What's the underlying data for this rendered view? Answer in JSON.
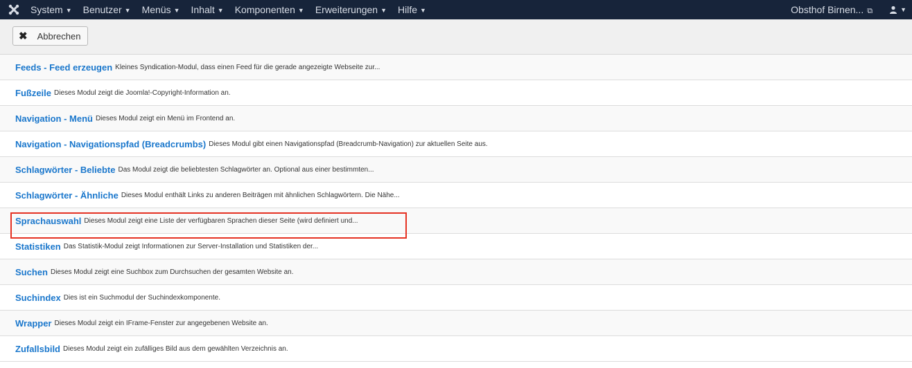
{
  "navbar": {
    "logo_icon": "joomla-logo-icon",
    "menu": [
      {
        "label": "System"
      },
      {
        "label": "Benutzer"
      },
      {
        "label": "Menüs"
      },
      {
        "label": "Inhalt"
      },
      {
        "label": "Komponenten"
      },
      {
        "label": "Erweiterungen"
      },
      {
        "label": "Hilfe"
      }
    ],
    "site_label": "Obsthof Birnen...",
    "user_icon": "user-icon"
  },
  "toolbar": {
    "cancel_label": "Abbrechen",
    "cancel_icon": "close-icon"
  },
  "modules": [
    {
      "title": "Feeds - Feed erzeugen",
      "desc": "Kleines Syndication-Modul, dass einen Feed für die gerade angezeigte Webseite zur..."
    },
    {
      "title": "Fußzeile",
      "desc": "Dieses Modul zeigt die Joomla!-Copyright-Information an."
    },
    {
      "title": "Navigation - Menü",
      "desc": "Dieses Modul zeigt ein Menü im Frontend an."
    },
    {
      "title": "Navigation - Navigationspfad (Breadcrumbs)",
      "desc": "Dieses Modul gibt einen Navigationspfad (Breadcrumb-Navigation) zur aktuellen Seite aus."
    },
    {
      "title": "Schlagwörter - Beliebte",
      "desc": "Das Modul zeigt die beliebtesten Schlagwörter an. Optional aus einer bestimmten..."
    },
    {
      "title": "Schlagwörter - Ähnliche",
      "desc": "Dieses Modul enthält Links zu anderen Beiträgen mit ähnlichen Schlagwörtern. Die Nähe..."
    },
    {
      "title": "Sprachauswahl",
      "desc": "Dieses Modul zeigt eine Liste der verfügbaren Sprachen dieser Seite (wird definiert und..."
    },
    {
      "title": "Statistiken",
      "desc": "Das Statistik-Modul zeigt Informationen zur Server-Installation und Statistiken der..."
    },
    {
      "title": "Suchen",
      "desc": "Dieses Modul zeigt eine Suchbox zum Durchsuchen der gesamten Website an."
    },
    {
      "title": "Suchindex",
      "desc": "Dies ist ein Suchmodul der Suchindexkomponente."
    },
    {
      "title": "Wrapper",
      "desc": "Dieses Modul zeigt ein IFrame-Fenster zur angegebenen Website an."
    },
    {
      "title": "Zufallsbild",
      "desc": "Dieses Modul zeigt ein zufälliges Bild aus dem gewählten Verzeichnis an."
    }
  ],
  "highlight_color": "#e53122"
}
